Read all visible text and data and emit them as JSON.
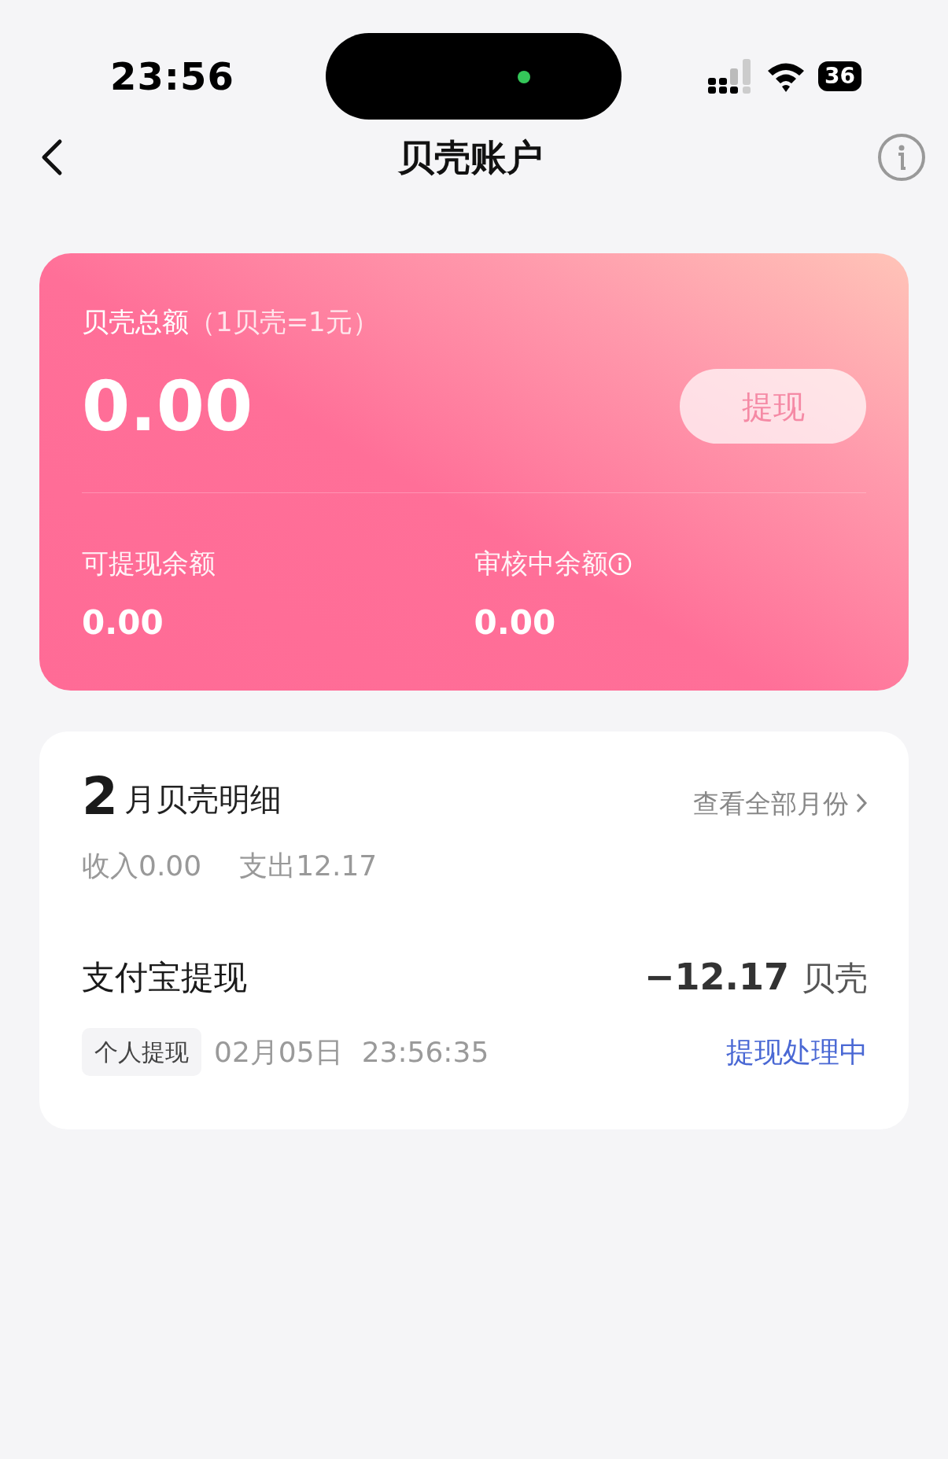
{
  "status_bar": {
    "time": "23:56",
    "battery": "36"
  },
  "nav": {
    "title": "贝壳账户"
  },
  "balance_card": {
    "label": "贝壳总额",
    "label_note": "（1贝壳=1元）",
    "amount": "0.00",
    "withdraw_button": {
      "label": "提现",
      "disabled": true
    },
    "sub_balances": [
      {
        "label": "可提现余额",
        "value": "0.00",
        "info": false
      },
      {
        "label": "审核中余额",
        "value": "0.00",
        "info": true
      }
    ]
  },
  "detail_card": {
    "month": "2",
    "title": "月贝壳明细",
    "view_all": "查看全部月份",
    "income": "收入0.00",
    "expense": "支出12.17",
    "transactions": [
      {
        "title": "支付宝提现",
        "amount": "−12.17",
        "unit": "贝壳",
        "tag": "个人提现",
        "date": "02月05日",
        "time": "23:56:35",
        "status": "提现处理中"
      }
    ]
  }
}
